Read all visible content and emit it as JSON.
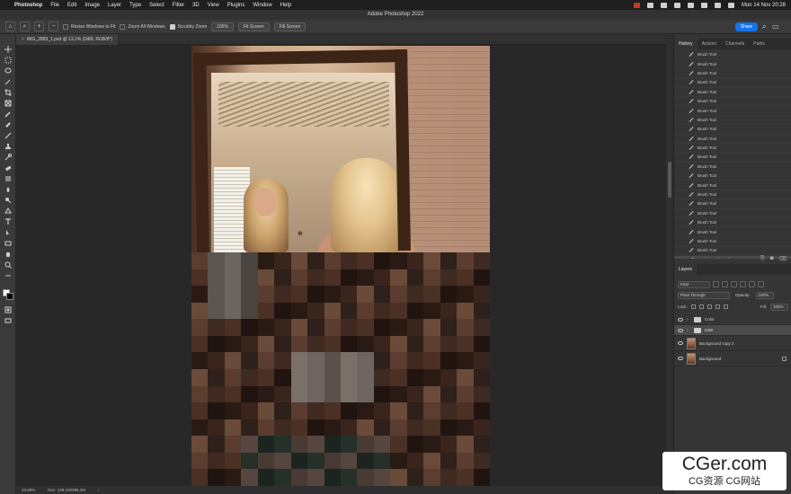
{
  "menubar": {
    "items": [
      "Photoshop",
      "File",
      "Edit",
      "Image",
      "Layer",
      "Type",
      "Select",
      "Filter",
      "3D",
      "View",
      "Plugins",
      "Window",
      "Help"
    ],
    "clock": "Mon 14 Nov  20:28"
  },
  "window": {
    "title": "Adobe Photoshop 2022"
  },
  "options": {
    "resize_windows": "Resize Windows to Fit",
    "zoom_all": "Zoom All Windows",
    "scrubby_zoom": "Scrubby Zoom",
    "zoom_100": "100%",
    "fit_screen": "Fit Screen",
    "fill_screen": "Fill Screen",
    "share": "Share"
  },
  "document": {
    "tab": "IMG_2883_1.psd @ 13,1% (D&B, RGB/8*)"
  },
  "status": {
    "zoom": "13,09%",
    "doc": "Doc: 128,1M/286,1M"
  },
  "history": {
    "tabs": [
      "History",
      "Actions",
      "Channels",
      "Paths"
    ],
    "items": [
      "Brush Tool",
      "Brush Tool",
      "Brush Tool",
      "Brush Tool",
      "Brush Tool",
      "Brush Tool",
      "Brush Tool",
      "Brush Tool",
      "Brush Tool",
      "Brush Tool",
      "Brush Tool",
      "Brush Tool",
      "Brush Tool",
      "Brush Tool",
      "Brush Tool",
      "Brush Tool",
      "Brush Tool",
      "Brush Tool",
      "Brush Tool",
      "Brush Tool",
      "Brush Tool",
      "Brush Tool"
    ],
    "last": "Brush Tool (Save)"
  },
  "layers": {
    "tab": "Layers",
    "filter": "Kind",
    "blend_mode": "Pass Through",
    "opacity_label": "Opacity:",
    "opacity": "100%",
    "lock_label": "Lock:",
    "fill_label": "Fill:",
    "fill": "100%",
    "rows": [
      {
        "name": "Color"
      },
      {
        "name": "D&B"
      },
      {
        "name": "Background copy 2"
      },
      {
        "name": "Background"
      }
    ]
  },
  "watermark": {
    "title": "CGer.com",
    "subtitle": "CG资源 CG网站"
  },
  "colors": {
    "accent": "#1473e6",
    "panel": "#353535",
    "canvas_bg": "#282828"
  }
}
